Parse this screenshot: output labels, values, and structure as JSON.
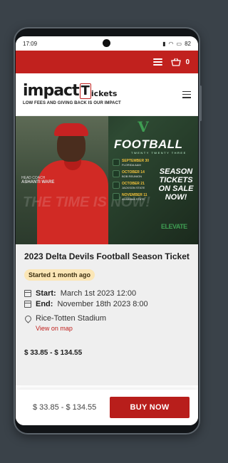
{
  "status_bar": {
    "time": "17:09",
    "battery": "82"
  },
  "topbar": {
    "cart_count": "0"
  },
  "logo": {
    "impact": "impact",
    "t": "T",
    "tickets": "ickets",
    "tagline": "LOW FEES AND GIVING BACK IS OUR IMPACT"
  },
  "banner": {
    "football": "FOOTBALL",
    "subtitle": "TWENTY TWENTY THREE",
    "season": "SEASON TICKETS ON SALE NOW!",
    "time_is": "THE TIME IS NOW!",
    "coach_label": "HEAD COACH",
    "coach_name": "ASHANTI WARE",
    "dates": [
      {
        "date": "SEPTEMBER 30",
        "opp": "FLORIDA A&M"
      },
      {
        "date": "OCTOBER 14",
        "opp": "BOB REUNION"
      },
      {
        "date": "OCTOBER 21",
        "opp": "JACKSON STATE"
      },
      {
        "date": "NOVEMBER 11",
        "opp": "ALABAMA STATE"
      }
    ],
    "bottom_logo": "ELEVATE"
  },
  "event": {
    "title": "2023 Delta Devils Football Season Ticket",
    "badge": "Started 1 month ago",
    "start_label": "Start:",
    "start_value": "March 1st 2023 12:00",
    "end_label": "End:",
    "end_value": "November 18th 2023 8:00",
    "venue": "Rice-Totten Stadium",
    "map_link": "View on map",
    "price_range": "$ 33.85 - $ 134.55"
  },
  "footer": {
    "price": "$ 33.85 - $ 134.55",
    "buy_label": "BUY NOW"
  },
  "colors": {
    "brand_red": "#c1211e",
    "badge_bg": "#fbe6b6",
    "banner_green": "#3e9d52"
  }
}
